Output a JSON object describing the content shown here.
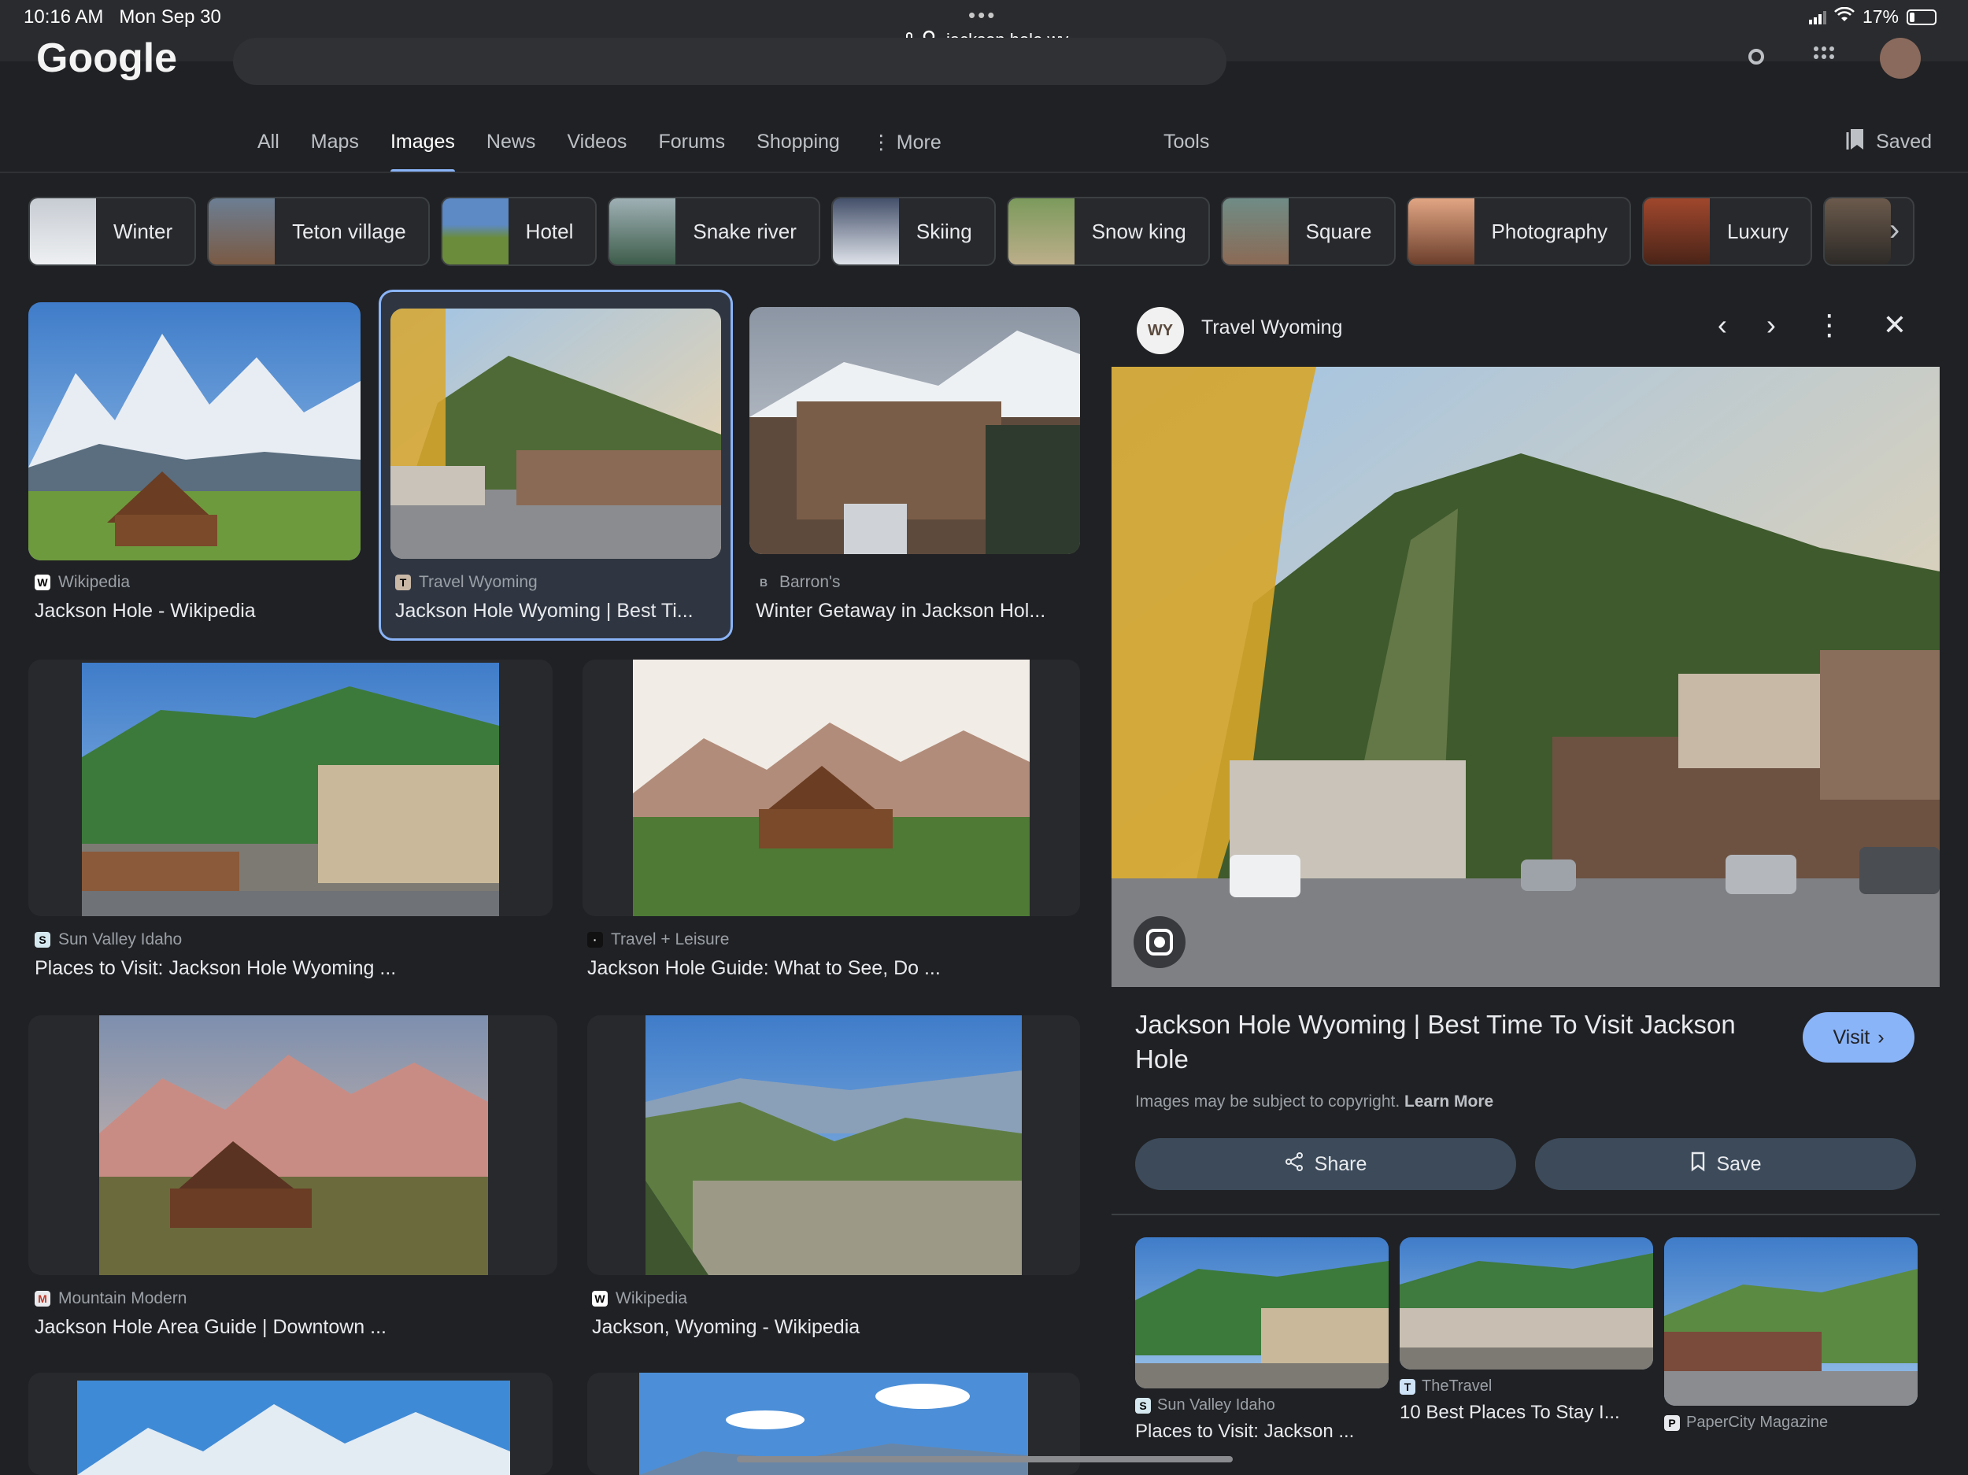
{
  "status": {
    "time": "10:16 AM",
    "date": "Mon Sep 30",
    "url": "jackson hole wy",
    "battery": "17%"
  },
  "header": {
    "logo_text": "Google",
    "tabs": [
      "All",
      "Maps",
      "Images",
      "News",
      "Videos",
      "Forums",
      "Shopping",
      "More"
    ],
    "active_tab": "Images",
    "tools_label": "Tools",
    "saved_label": "Saved"
  },
  "chips": [
    "Winter",
    "Teton village",
    "Hotel",
    "Snake river",
    "Skiing",
    "Snow king",
    "Square",
    "Photography",
    "Luxury"
  ],
  "results": [
    {
      "source": "Wikipedia",
      "title": "Jackson Hole - Wikipedia"
    },
    {
      "source": "Travel Wyoming",
      "title": "Jackson Hole Wyoming | Best Ti..."
    },
    {
      "source": "Barron's",
      "title": "Winter Getaway in Jackson Hol..."
    },
    {
      "source": "Sun Valley Idaho",
      "title": "Places to Visit: Jackson Hole Wyoming ..."
    },
    {
      "source": "Travel + Leisure",
      "title": "Jackson Hole Guide: What to See, Do ..."
    },
    {
      "source": "Mountain Modern",
      "title": "Jackson Hole Area Guide | Downtown ..."
    },
    {
      "source": "Wikipedia",
      "title": "Jackson, Wyoming - Wikipedia"
    }
  ],
  "panel": {
    "source_name": "Travel Wyoming",
    "source_logo_text": "WY",
    "title": "Jackson Hole Wyoming | Best Time To Visit Jackson Hole",
    "visit_label": "Visit",
    "copyright_text": "Images may be subject to copyright.",
    "learn_more": "Learn More",
    "share_label": "Share",
    "save_label": "Save",
    "related": [
      {
        "source": "Sun Valley Idaho",
        "title": "Places to Visit: Jackson ..."
      },
      {
        "source": "TheTravel",
        "title": "10 Best Places To Stay I..."
      },
      {
        "source": "PaperCity Magazine",
        "title": ""
      }
    ]
  },
  "colors": {
    "background": "#202124",
    "accent": "#8ab4f8",
    "button": "#3c4a5a"
  }
}
